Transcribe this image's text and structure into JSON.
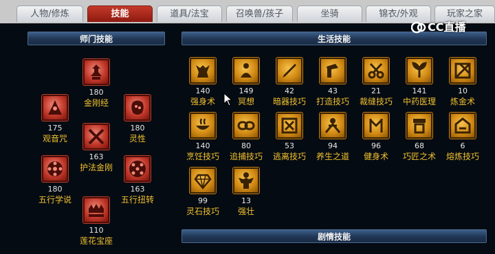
{
  "tabs": [
    "人物/修炼",
    "技能",
    "道具/法宝",
    "召唤兽/孩子",
    "坐骑",
    "锦衣/外观",
    "玩家之家"
  ],
  "active_tab": "技能",
  "watermark": "CC直播",
  "sections": {
    "school": "师门技能",
    "life": "生活技能",
    "story": "剧情技能"
  },
  "school_skills": [
    {
      "level": "180",
      "name": "金刚经",
      "icon": "pagoda-icon"
    },
    {
      "level": "175",
      "name": "观音咒",
      "icon": "stupa-icon"
    },
    {
      "level": "180",
      "name": "灵性",
      "icon": "spirit-face-icon"
    },
    {
      "level": "163",
      "name": "护法金刚",
      "icon": "vajra-icon"
    },
    {
      "level": "180",
      "name": "五行学说",
      "icon": "five-elements-wheel-icon"
    },
    {
      "level": "163",
      "name": "五行扭转",
      "icon": "five-elements-grid-icon"
    },
    {
      "level": "110",
      "name": "莲花宝座",
      "icon": "lotus-throne-icon"
    }
  ],
  "life_skills": [
    {
      "level": "140",
      "name": "强身术",
      "icon": "body-strength-icon"
    },
    {
      "level": "149",
      "name": "冥想",
      "icon": "meditation-icon"
    },
    {
      "level": "42",
      "name": "暗器技巧",
      "icon": "dart-icon"
    },
    {
      "level": "43",
      "name": "打造技巧",
      "icon": "forge-icon"
    },
    {
      "level": "21",
      "name": "裁缝技巧",
      "icon": "scissors-icon"
    },
    {
      "level": "141",
      "name": "中药医理",
      "icon": "herb-icon"
    },
    {
      "level": "10",
      "name": "炼金术",
      "icon": "alchemy-icon"
    },
    {
      "level": "140",
      "name": "烹饪技巧",
      "icon": "cooking-icon"
    },
    {
      "level": "80",
      "name": "追捕技巧",
      "icon": "chain-icon"
    },
    {
      "level": "53",
      "name": "逃离技巧",
      "icon": "escape-icon"
    },
    {
      "level": "94",
      "name": "养生之道",
      "icon": "health-icon"
    },
    {
      "level": "96",
      "name": "健身术",
      "icon": "fitness-icon"
    },
    {
      "level": "68",
      "name": "巧匠之术",
      "icon": "craftsman-icon"
    },
    {
      "level": "6",
      "name": "熔炼技巧",
      "icon": "smelting-icon"
    },
    {
      "level": "99",
      "name": "灵石技巧",
      "icon": "gem-icon"
    },
    {
      "level": "13",
      "name": "强壮",
      "icon": "strong-icon"
    }
  ]
}
